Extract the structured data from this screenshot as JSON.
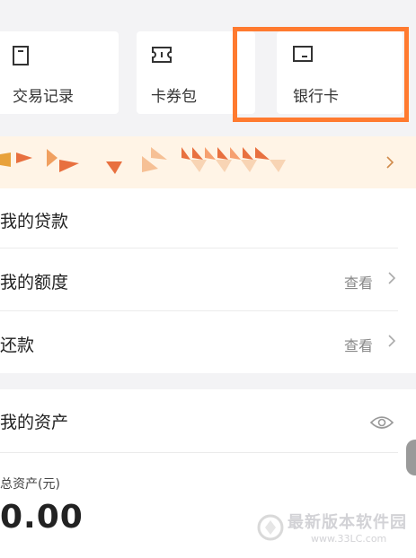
{
  "quick_actions": [
    {
      "label": "交易记录",
      "icon": "document-icon"
    },
    {
      "label": "卡券包",
      "icon": "ticket-icon"
    },
    {
      "label": "银行卡",
      "icon": "bank-card-icon"
    }
  ],
  "highlight_color": "#ff7a2f",
  "loans_section": {
    "title": "我的贷款",
    "rows": [
      {
        "label": "我的额度",
        "action": "查看"
      },
      {
        "label": "还款",
        "action": "查看"
      }
    ]
  },
  "assets_section": {
    "title": "我的资产",
    "total_label": "总资产(元)",
    "total_value": "0.00"
  },
  "watermark": {
    "text": "最新版本软件园",
    "url": "www.33LC.com"
  }
}
